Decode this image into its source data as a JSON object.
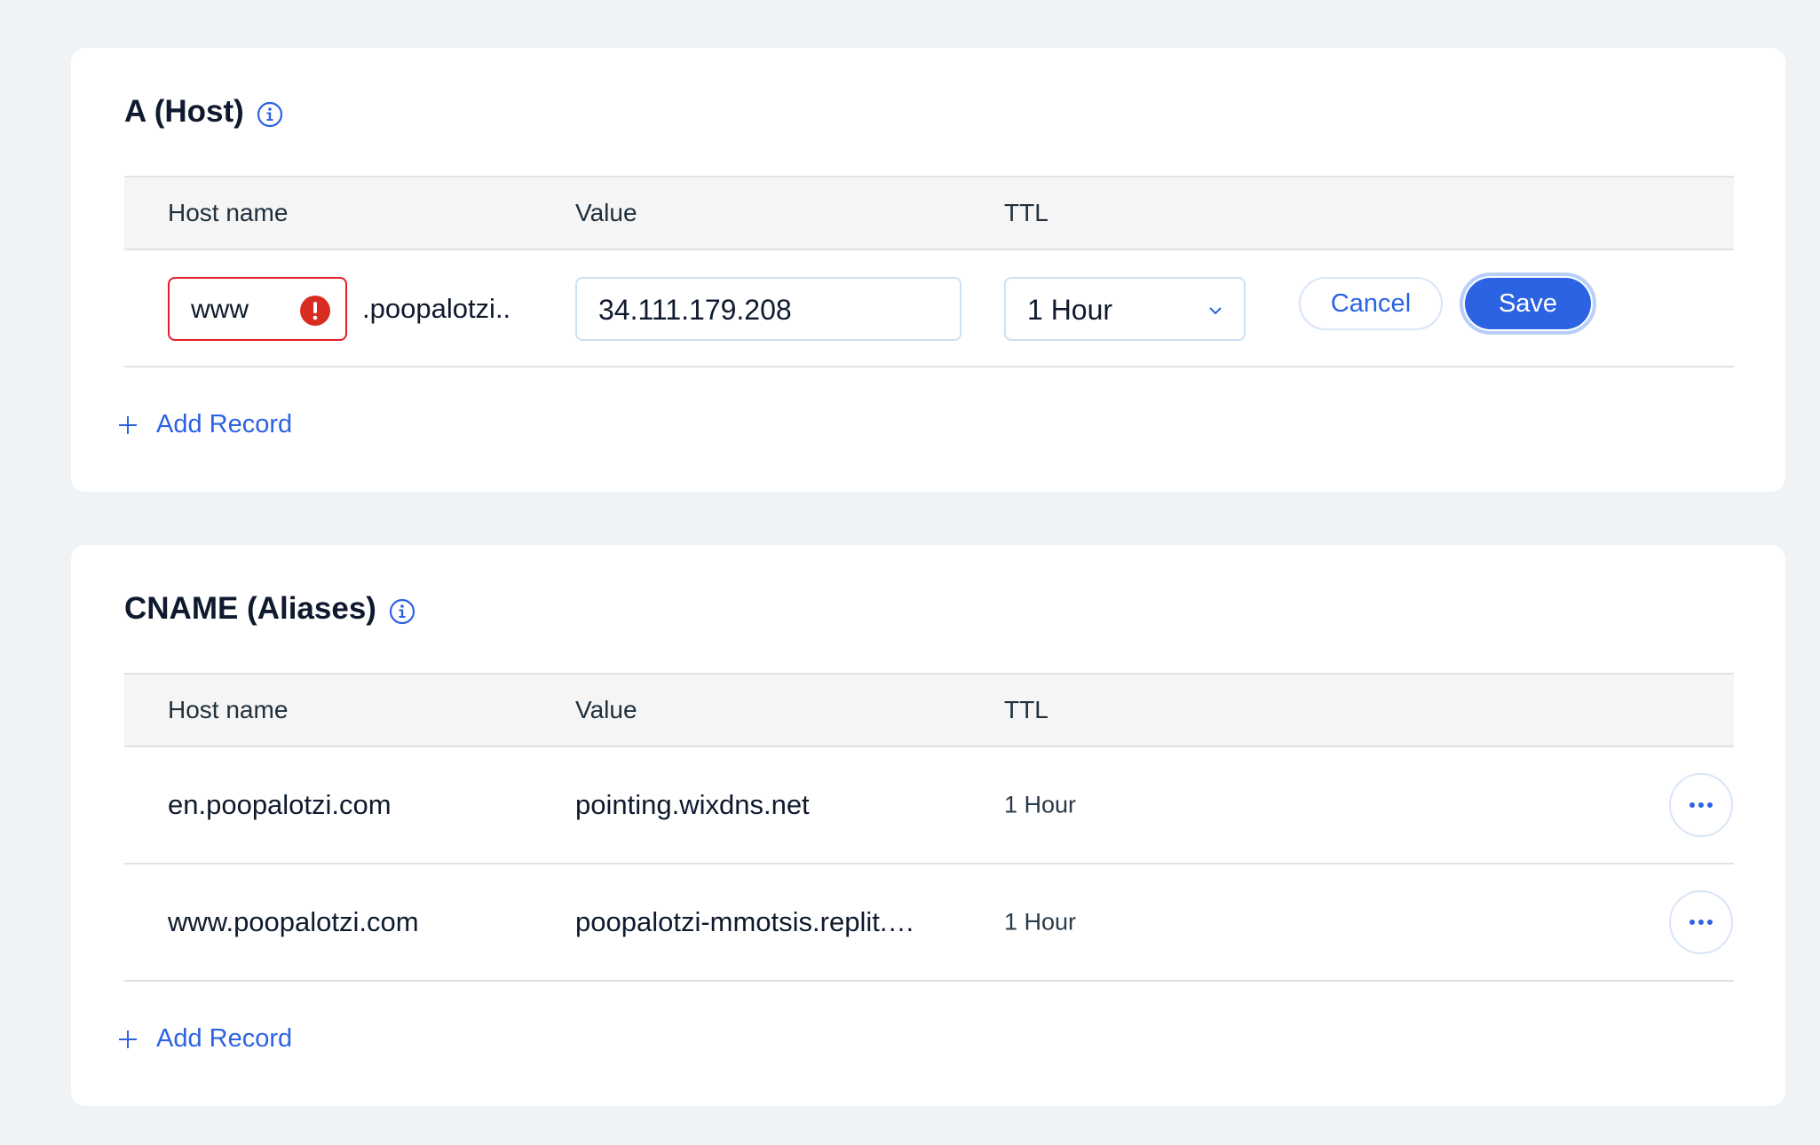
{
  "a_section": {
    "title": "A (Host)",
    "columns": [
      "Host name",
      "Value",
      "TTL"
    ],
    "edit_row": {
      "host_value": "www",
      "domain_suffix": ".poopalotzi..",
      "value": "34.111.179.208",
      "ttl_selected": "1 Hour",
      "cancel_label": "Cancel",
      "save_label": "Save"
    },
    "add_record_label": "Add Record"
  },
  "cname_section": {
    "title": "CNAME (Aliases)",
    "columns": [
      "Host name",
      "Value",
      "TTL"
    ],
    "rows": [
      {
        "host": "en.poopalotzi.com",
        "value": "pointing.wixdns.net",
        "ttl": "1 Hour"
      },
      {
        "host": "www.poopalotzi.com",
        "value": "poopalotzi-mmotsis.replit.…",
        "ttl": "1 Hour"
      }
    ],
    "add_record_label": "Add Record"
  },
  "colors": {
    "accent": "#2b63e3",
    "error": "#e0202b",
    "background": "#f0f3f6",
    "card": "#ffffff",
    "header_row": "#f5f5f5"
  },
  "icons": [
    "info-icon",
    "error-icon",
    "chevron-down-icon",
    "plus-icon",
    "more-options-icon"
  ]
}
